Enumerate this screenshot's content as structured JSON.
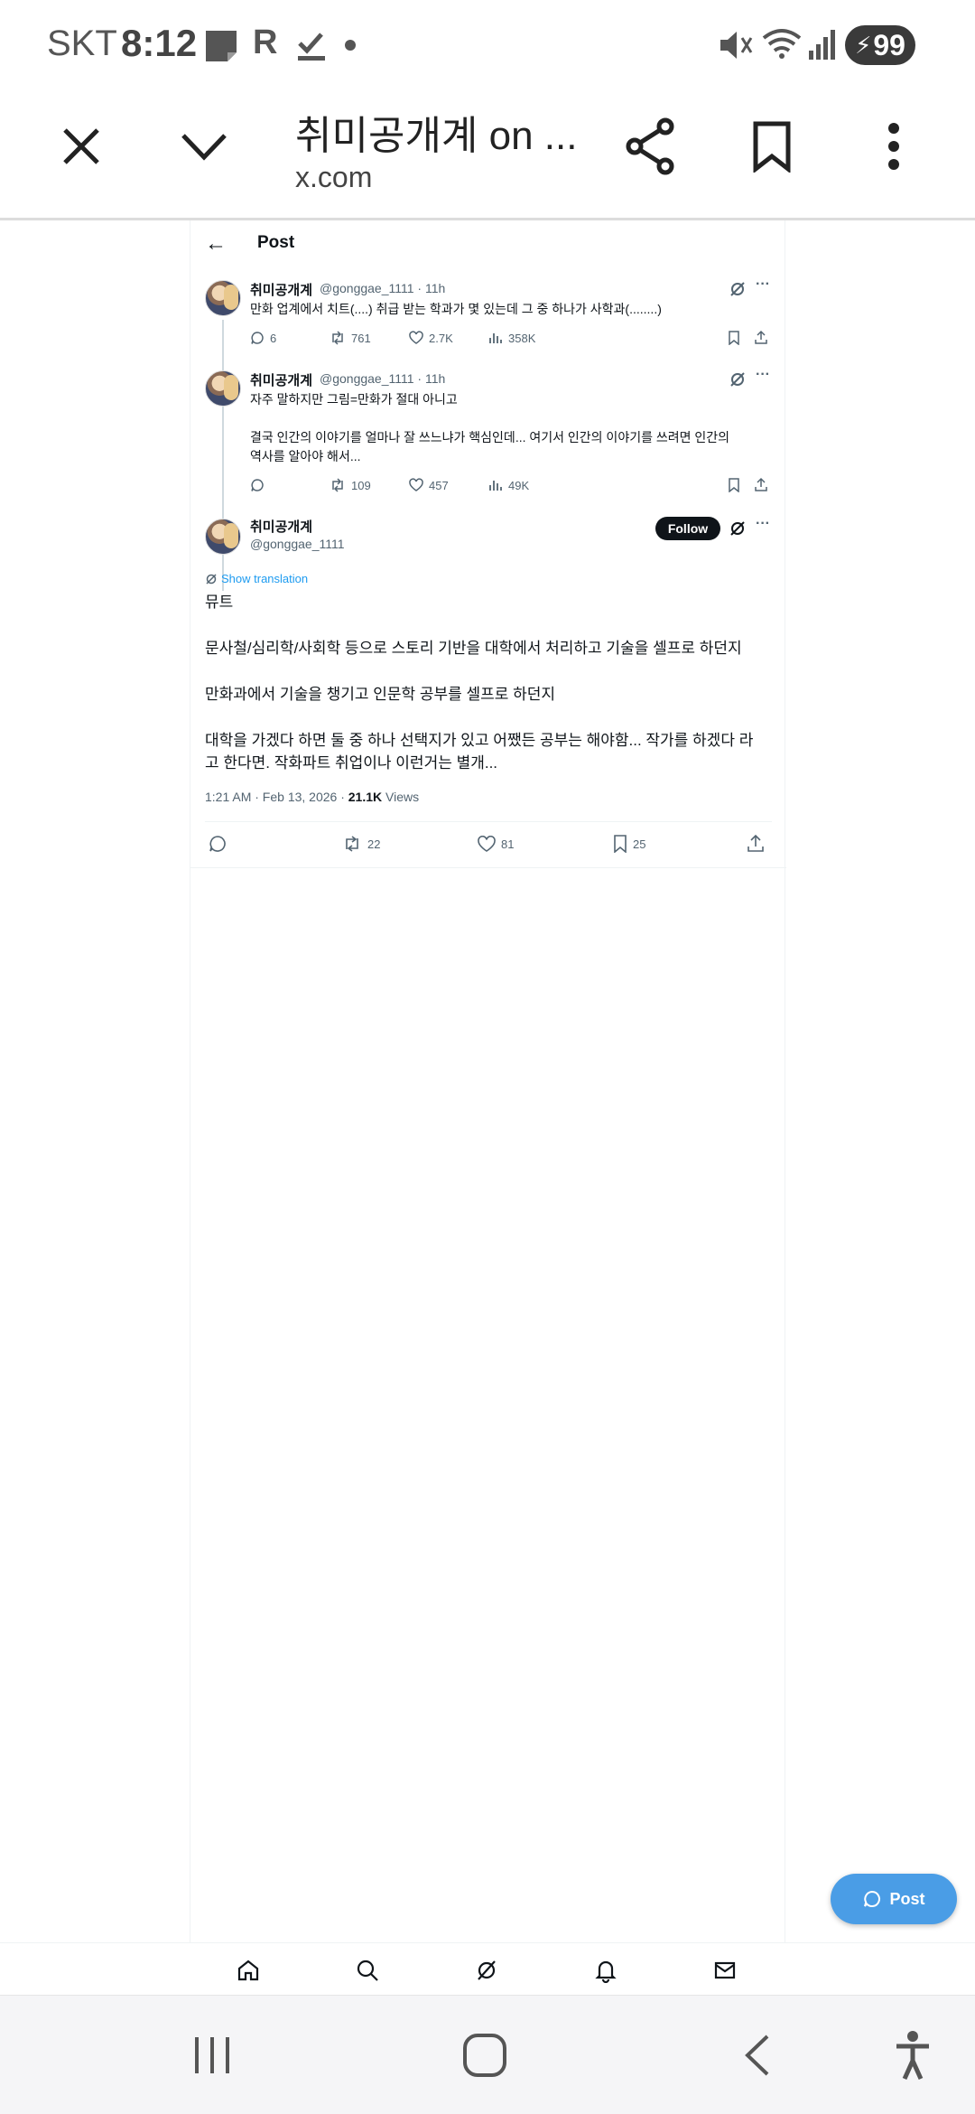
{
  "status_bar": {
    "carrier": "SKT",
    "time": "8:12",
    "battery": "99",
    "notification_icons": [
      "note-icon",
      "r-app-icon",
      "download-check-icon",
      "dot-icon"
    ],
    "system_icons": [
      "mute-icon",
      "wifi-icon",
      "signal-icon",
      "battery-charging-icon"
    ]
  },
  "browser": {
    "title": "취미공개계 on ...",
    "url": "x.com"
  },
  "page": {
    "header_title": "Post"
  },
  "tweets": [
    {
      "name": "취미공개계",
      "handle_time": "@gonggae_1111 · 11h",
      "text": "만화 업계에서 치트(....) 취급 받는 학과가 몇 있는데 그 중 하나가 사학과(........)",
      "replies": "6",
      "retweets": "761",
      "likes": "2.7K",
      "views": "358K"
    },
    {
      "name": "취미공개계",
      "handle_time": "@gonggae_1111 · 11h",
      "text": "자주 말하지만 그림=만화가 절대 아니고\n\n결국 인간의 이야기를 얼마나 잘 쓰느냐가 핵심인데... 여기서 인간의 이야기를 쓰려면 인간의\n역사를 알아야 해서...",
      "replies": "",
      "retweets": "109",
      "likes": "457",
      "views": "49K"
    }
  ],
  "main_tweet": {
    "name": "취미공개계",
    "handle": "@gonggae_1111",
    "follow_label": "Follow",
    "show_translation": "Show translation",
    "paragraphs": [
      "뮤트",
      "문사철/심리학/사회학 등으로 스토리 기반을 대학에서 처리하고 기술을 셀프로 하던지",
      "만화과에서 기술을 챙기고 인문학 공부를 셀프로 하던지",
      "대학을 가겠다 하면 둘 중 하나 선택지가 있고 어쨌든 공부는 해야함... 작가를 하겠다 라\n고 한다면. 작화파트 취업이나 이런거는 별개..."
    ],
    "timestamp": "1:21 AM · Feb 13, 2026 · ",
    "views_count": "21.1K",
    "views_label": " Views",
    "retweets": "22",
    "likes": "81",
    "bookmarks": "25"
  },
  "fab": {
    "label": "Post"
  },
  "colors": {
    "accent": "#4a9de6",
    "text": "#0f1419",
    "muted": "#536471",
    "link": "#1d9bf0"
  }
}
